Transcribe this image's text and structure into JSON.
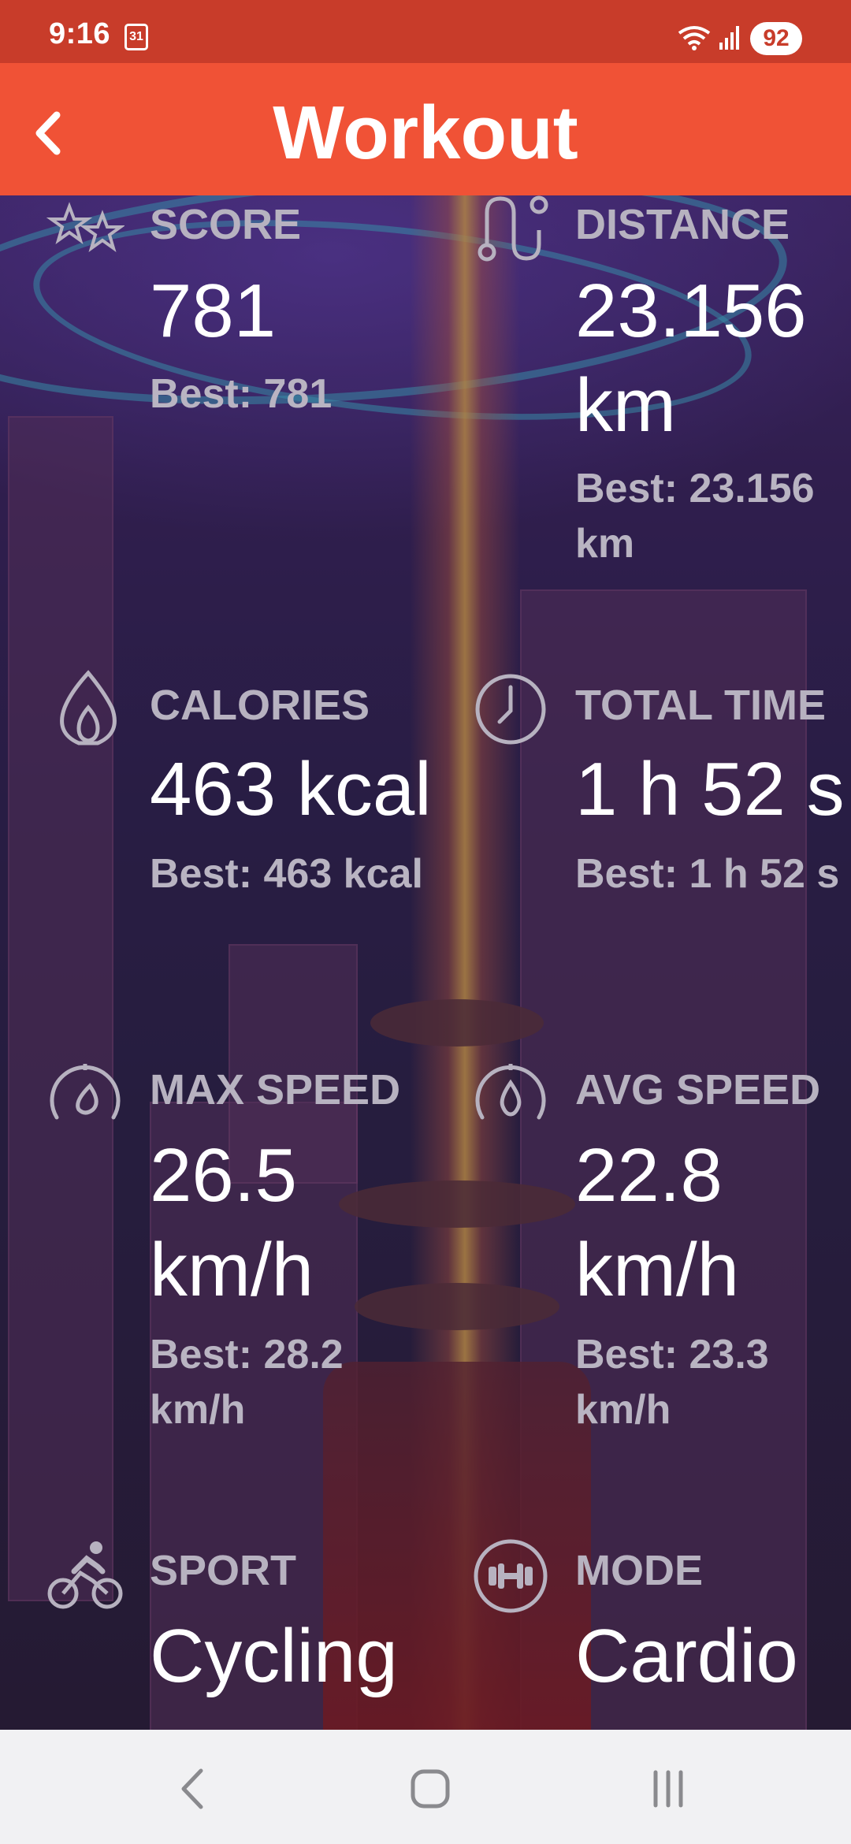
{
  "status_bar": {
    "time": "9:16",
    "calendar_day": "31",
    "battery": "92"
  },
  "app_bar": {
    "title": "Workout"
  },
  "stats": {
    "score": {
      "label": "SCORE",
      "value": "781",
      "best": "Best: 781"
    },
    "distance": {
      "label": "DISTANCE",
      "value": "23.156 km",
      "best": "Best: 23.156 km"
    },
    "calories": {
      "label": "CALORIES",
      "value": "463 kcal",
      "best": "Best: 463 kcal"
    },
    "total_time": {
      "label": "TOTAL TIME",
      "value": "1 h 52 s",
      "best": "Best: 1 h 52 s"
    },
    "max_speed": {
      "label": "MAX SPEED",
      "value": "26.5 km/h",
      "best": "Best: 28.2 km/h"
    },
    "avg_speed": {
      "label": "AVG SPEED",
      "value": "22.8 km/h",
      "best": "Best: 23.3 km/h"
    },
    "sport": {
      "label": "SPORT",
      "value": "Cycling"
    },
    "mode": {
      "label": "MODE",
      "value": "Cardio"
    }
  },
  "icons": {
    "back": "back-arrow-icon",
    "score": "stars-icon",
    "distance": "route-icon",
    "calories": "flame-icon",
    "total_time": "clock-icon",
    "max_speed": "speedometer-icon",
    "avg_speed": "speedometer-drop-icon",
    "sport": "cyclist-icon",
    "mode": "dumbbell-icon"
  },
  "colors": {
    "status_bar": "#c83c2a",
    "app_bar": "#f05236",
    "label": "#b7b2c0",
    "value": "#ffffff",
    "nav_bar": "#f1f1f3"
  }
}
